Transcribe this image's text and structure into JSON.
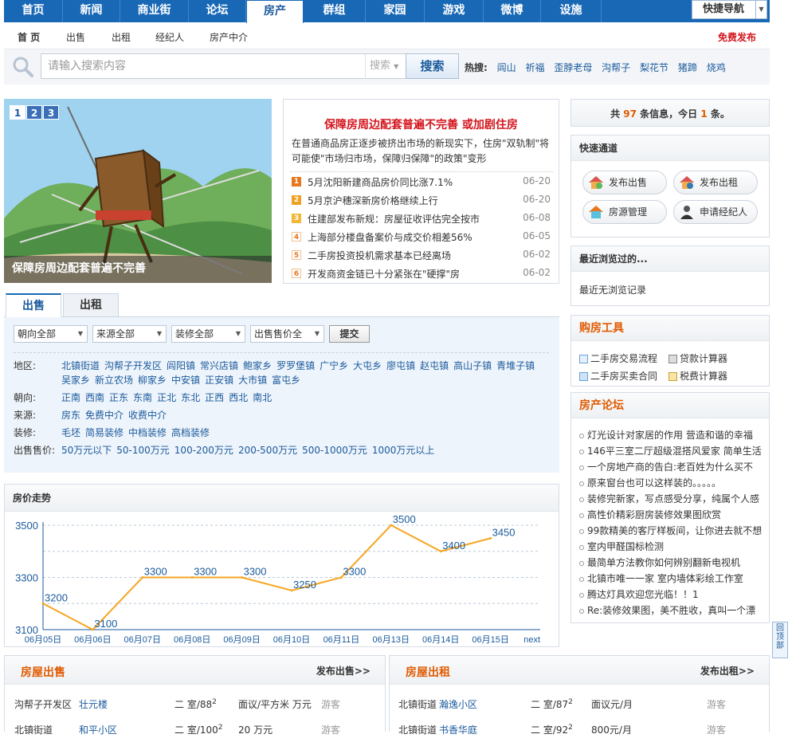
{
  "topnav": {
    "items": [
      "首页",
      "新闻",
      "商业街",
      "论坛",
      "房产",
      "群组",
      "家园",
      "游戏",
      "微博",
      "设施"
    ],
    "quick_nav": "快捷导航"
  },
  "subnav": {
    "items": [
      "首 页",
      "出售",
      "出租",
      "经纪人",
      "房产中介"
    ],
    "publish": "免费发布"
  },
  "search": {
    "placeholder": "请输入搜索内容",
    "type": "搜索",
    "button": "搜索",
    "hot_label": "热搜:",
    "hot": [
      "闾山",
      "祈福",
      "歪脖老母",
      "沟帮子",
      "梨花节",
      "猪蹄",
      "烧鸡"
    ]
  },
  "slideshow": {
    "pages": [
      "1",
      "2",
      "3"
    ],
    "caption": "保障房周边配套普遍不完善"
  },
  "news": {
    "headline": "保障房周边配套普遍不完善 或加剧住房",
    "intro": "在普通商品房正逐步被挤出市场的新现实下，住房\"双轨制\"将可能使\"市场归市场，保障归保障\"的政策\"变形",
    "items": [
      {
        "n": "1",
        "title": "5月沈阳新建商品房价同比涨7.1%",
        "date": "06-20"
      },
      {
        "n": "2",
        "title": "5月京沪穗深新房价格继续上行",
        "date": "06-20"
      },
      {
        "n": "3",
        "title": "住建部发布新规：房屋征收评估完全按市",
        "date": "06-08"
      },
      {
        "n": "4",
        "title": "上海部分楼盘备案价与成交价相差56%",
        "date": "06-05"
      },
      {
        "n": "5",
        "title": "二手房投资投机需求基本已经离场",
        "date": "06-02"
      },
      {
        "n": "6",
        "title": "开发商资金链已十分紧张在\"硬撑\"房",
        "date": "06-02"
      }
    ]
  },
  "tabs": [
    "出售",
    "出租"
  ],
  "filter": {
    "selects": [
      "朝向全部",
      "来源全部",
      "装修全部",
      "出售售价全"
    ],
    "submit": "提交",
    "rows": [
      {
        "label": "地区:",
        "options": [
          "北镇街道",
          "沟帮子开发区",
          "闾阳镇",
          "常兴店镇",
          "鲍家乡",
          "罗罗堡镇",
          "广宁乡",
          "大屯乡",
          "廖屯镇",
          "赵屯镇",
          "高山子镇",
          "青堆子镇",
          "吴家乡",
          "新立农场",
          "柳家乡",
          "中安镇",
          "正安镇",
          "大市镇",
          "富屯乡"
        ]
      },
      {
        "label": "朝向:",
        "options": [
          "正南",
          "西南",
          "正东",
          "东南",
          "正北",
          "东北",
          "正西",
          "西北",
          "南北"
        ]
      },
      {
        "label": "来源:",
        "options": [
          "房东",
          "免费中介",
          "收费中介"
        ]
      },
      {
        "label": "装修:",
        "options": [
          "毛坯",
          "简易装修",
          "中档装修",
          "高档装修"
        ]
      },
      {
        "label": "出售售价:",
        "options": [
          "50万元以下",
          "50-100万元",
          "100-200万元",
          "200-500万元",
          "500-1000万元",
          "1000万元以上"
        ]
      }
    ]
  },
  "price_trend": {
    "title": "房价走势",
    "next": "next"
  },
  "chart_data": {
    "type": "line",
    "x": [
      "06月05日",
      "06月06日",
      "06月07日",
      "06月08日",
      "06月09日",
      "06月10日",
      "06月11日",
      "06月13日",
      "06月14日",
      "06月15日"
    ],
    "values": [
      3200,
      3100,
      3300,
      3300,
      3300,
      3250,
      3300,
      3500,
      3400,
      3450
    ],
    "y_ticks": [
      3100,
      3300,
      3500
    ],
    "ylim": [
      3100,
      3500
    ],
    "grid": true,
    "colors": {
      "line": "#f5a623",
      "axis": "#1a5a9c"
    }
  },
  "sale_box": {
    "title": "房屋出售",
    "more": "发布出售>>",
    "rows": [
      {
        "area": "沟帮子开发区",
        "name": "壮元楼",
        "rooms": "二 室/88",
        "sup": "2",
        "price": "面议/平方米 万元",
        "who": "游客"
      },
      {
        "area": "北镇街道",
        "name": "和平小区",
        "rooms": "二 室/100",
        "sup": "2",
        "price": "20 万元",
        "who": "游客"
      }
    ]
  },
  "rent_box": {
    "title": "房屋出租",
    "more": "发布出租>>",
    "rows": [
      {
        "area": "北镇街道",
        "name": "瀚逸小区",
        "rooms": "二 室/87",
        "sup": "2",
        "price": "面议元/月",
        "who": "游客"
      },
      {
        "area": "北镇街道",
        "name": "书香华庭",
        "rooms": "二 室/92",
        "sup": "2",
        "price": "800元/月",
        "who": "游客"
      }
    ]
  },
  "stats": {
    "prefix": "共",
    "total": "97",
    "mid": "条信息，今日",
    "today": "1",
    "suffix": "条。"
  },
  "quick_channel": {
    "title": "快速通道",
    "buttons": [
      "发布出售",
      "发布出租",
      "房源管理",
      "申请经纪人"
    ]
  },
  "recent": {
    "title": "最近浏览过的...",
    "empty": "最近无浏览记录"
  },
  "tools": {
    "title": "购房工具",
    "items": [
      "二手房交易流程",
      "贷款计算器",
      "二手房买卖合同",
      "税费计算器"
    ]
  },
  "forum": {
    "title": "房产论坛",
    "items": [
      "灯光设计对家居的作用 营造和谐的幸福",
      "146平三室二厅超级混搭风爱家 简单生活",
      "一个房地产商的告白:老百姓为什么买不",
      "原来窗台也可以这样装的。。。。。",
      "装修完新家，写点感受分享，纯属个人感",
      "高性价精彩厨房装修效果图欣赏",
      "99款精美的客厅样板间，让你进去就不想",
      "室内甲醛国标检测",
      "最简单方法教你如何辨别翻新电视机",
      "北镇市唯一一家 室内墙体彩绘工作室",
      "腾达灯具欢迎您光临！！1",
      "Re:装修效果图，美不胜收，真叫一个漂"
    ]
  },
  "totop": "回顶部"
}
